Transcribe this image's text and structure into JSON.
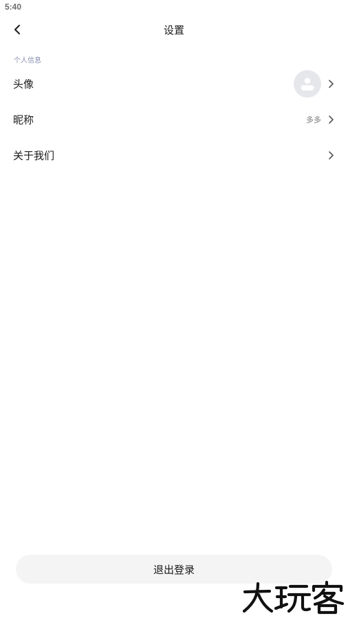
{
  "status_bar": {
    "time": "5:40"
  },
  "nav": {
    "title": "设置",
    "back_icon": "chevron-left-icon"
  },
  "section": {
    "label": "个人信息"
  },
  "rows": [
    {
      "label": "头像",
      "value": "",
      "trailing": "avatar"
    },
    {
      "label": "昵称",
      "value": "多多",
      "trailing": "text"
    },
    {
      "label": "关于我们",
      "value": "",
      "trailing": "none"
    }
  ],
  "logout": {
    "label": "退出登录"
  },
  "watermark": {
    "text": "大玩客"
  },
  "colors": {
    "background": "#ffffff",
    "text_primary": "#1a1a1a",
    "section_label": "#8a8fb0",
    "value_text": "#7a7a7a",
    "avatar_bg": "#e6e7eb",
    "avatar_fg": "#ffffff",
    "button_bg": "#f4f4f5",
    "chevron": "#555555"
  }
}
